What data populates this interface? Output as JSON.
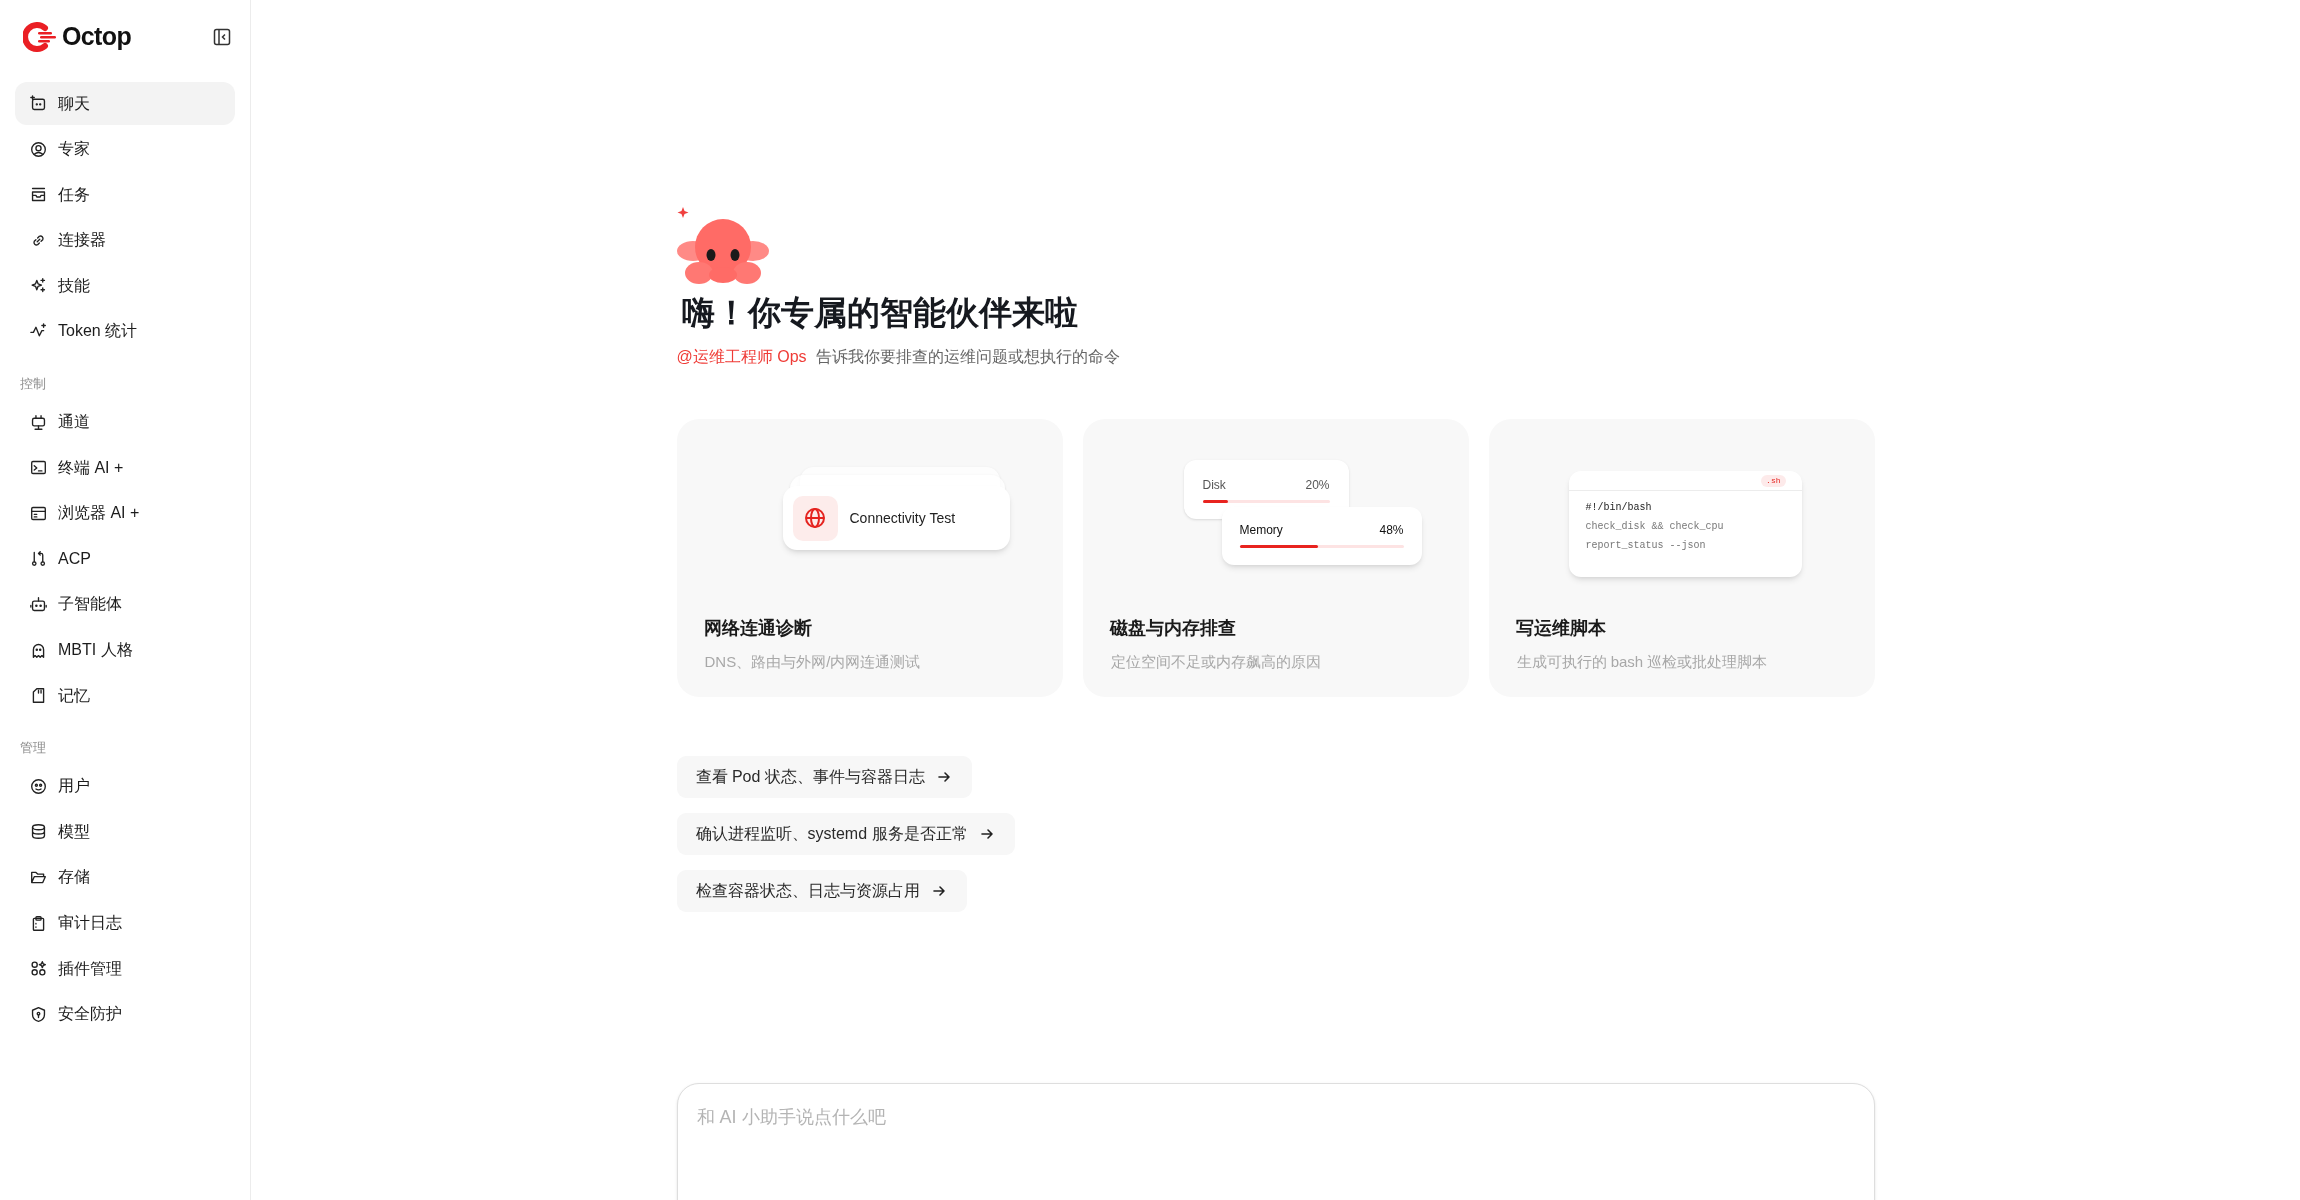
{
  "sidebar": {
    "logo": "Octop",
    "groups": [
      {
        "items": [
          {
            "label": "聊天",
            "selected": true
          },
          {
            "label": "专家",
            "selected": false
          },
          {
            "label": "任务",
            "selected": false
          },
          {
            "label": "连接器",
            "selected": false
          },
          {
            "label": "技能",
            "selected": false
          },
          {
            "label": "Token 统计",
            "selected": false
          }
        ]
      },
      {
        "title": "控制",
        "items": [
          {
            "label": "通道",
            "selected": false
          },
          {
            "label": "终端 AI +",
            "selected": false
          },
          {
            "label": "浏览器 AI +",
            "selected": false
          },
          {
            "label": "ACP",
            "selected": false
          },
          {
            "label": "子智能体",
            "selected": false
          },
          {
            "label": "MBTI 人格",
            "selected": false
          },
          {
            "label": "记忆",
            "selected": false
          }
        ]
      },
      {
        "title": "管理",
        "items": [
          {
            "label": "用户",
            "selected": false
          },
          {
            "label": "模型",
            "selected": false
          },
          {
            "label": "存储",
            "selected": false
          },
          {
            "label": "审计日志",
            "selected": false
          },
          {
            "label": "插件管理",
            "selected": false
          },
          {
            "label": "安全防护",
            "selected": false
          }
        ]
      }
    ]
  },
  "hero": {
    "title": "嗨！你专属的智能伙伴来啦",
    "agent": "@运维工程师 Ops",
    "hint": "告诉我你要排查的运维问题或想执行的命令"
  },
  "cards": [
    {
      "kind": "connectivity",
      "title": "网络连通诊断",
      "description": "DNS、路由与外网/内网连通测试",
      "preview": {
        "label": "Connectivity Test"
      }
    },
    {
      "kind": "resources",
      "title": "磁盘与内存排查",
      "description": "定位空间不足或内存飙高的原因",
      "preview": {
        "meters": [
          {
            "name": "Disk",
            "reading": "20%",
            "level": 0.2
          },
          {
            "name": "Memory",
            "reading": "48%",
            "level": 0.48
          }
        ]
      }
    },
    {
      "kind": "script",
      "title": "写运维脚本",
      "description": "生成可执行的 bash 巡检或批处理脚本",
      "preview": {
        "badge": ".sh",
        "lines": [
          "#!/bin/bash",
          "check_disk && check_cpu",
          "report_status --json"
        ]
      }
    }
  ],
  "suggestions": [
    "查看 Pod 状态、事件与容器日志",
    "确认进程监听、systemd 服务是否正常",
    "检查容器状态、日志与资源占用"
  ],
  "composer": {
    "placeholder": "和 AI 小助手说点什么吧"
  }
}
